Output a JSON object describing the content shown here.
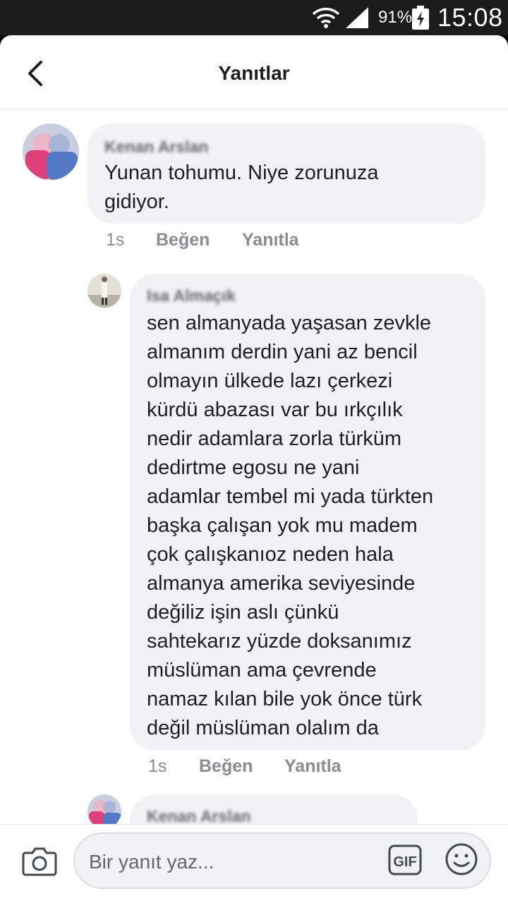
{
  "status_bar": {
    "battery_percent": "91%",
    "time": "15:08"
  },
  "header": {
    "title": "Yanıtlar",
    "back_icon": "chevron-left-icon"
  },
  "comments": [
    {
      "author": "Kenan Arslan",
      "text_lines": [
        "Yunan tohumu. Niye zorunuza",
        "gidiyor."
      ],
      "time": "1s",
      "like_label": "Beğen",
      "reply_label": "Yanıtla"
    },
    {
      "author": "Isa Almaçık",
      "text_lines": [
        "sen almanyada yaşasan zevkle",
        "almanım derdin yani az bencil",
        "olmayın ülkede lazı çerkezi",
        "kürdü abazası var bu ırkçılık",
        "nedir adamlara zorla türküm",
        "dedirtme egosu ne yani",
        "adamlar tembel mi yada türkten",
        "başka çalışan yok mu madem",
        "çok çalışkanıoz neden hala",
        "almanya amerika seviyesinde",
        "değiliz işin aslı çünkü",
        "sahtekarız yüzde doksanımız",
        "müslüman ama çevrende",
        "namaz kılan bile yok önce türk",
        "değil müslüman olalım da"
      ],
      "time": "1s",
      "like_label": "Beğen",
      "reply_label": "Yanıtla"
    },
    {
      "author": "Kenan Arslan"
    }
  ],
  "composer": {
    "placeholder": "Bir yanıt yaz...",
    "gif_label": "GIF",
    "camera_icon": "camera-icon",
    "emoji_icon": "emoji-icon"
  },
  "colors": {
    "bubble": "#f0f2f5",
    "meta_text": "#8a8d91",
    "status_bar": "#1b1b1b"
  }
}
